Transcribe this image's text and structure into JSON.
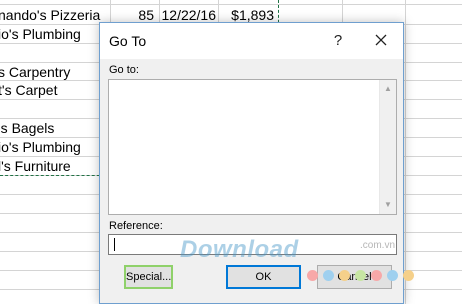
{
  "spreadsheet": {
    "row1": {
      "name": "nando's Pizzeria",
      "qty": "85",
      "date": "12/22/16",
      "amount": "$1,893"
    },
    "names": [
      "io's Plumbing",
      "s Carpentry",
      "t's Carpet",
      "'s Bagels",
      "io's Plumbing",
      "l's Furniture"
    ]
  },
  "dialog": {
    "title": "Go To",
    "help_label": "?",
    "goto_label": "Go to:",
    "reference_label": "Reference:",
    "reference_value": "",
    "buttons": {
      "special": "Special...",
      "ok": "OK",
      "cancel": "Cancel"
    }
  },
  "watermark": {
    "text": "Download",
    "suffix": ".com.vn"
  },
  "colors": {
    "accent": "#0078d7",
    "highlight": "#8fd16a",
    "selection_border": "#217346"
  },
  "icons": {
    "close": "close-icon",
    "scroll_up": "scroll-up-arrow-icon",
    "scroll_down": "scroll-down-arrow-icon"
  }
}
